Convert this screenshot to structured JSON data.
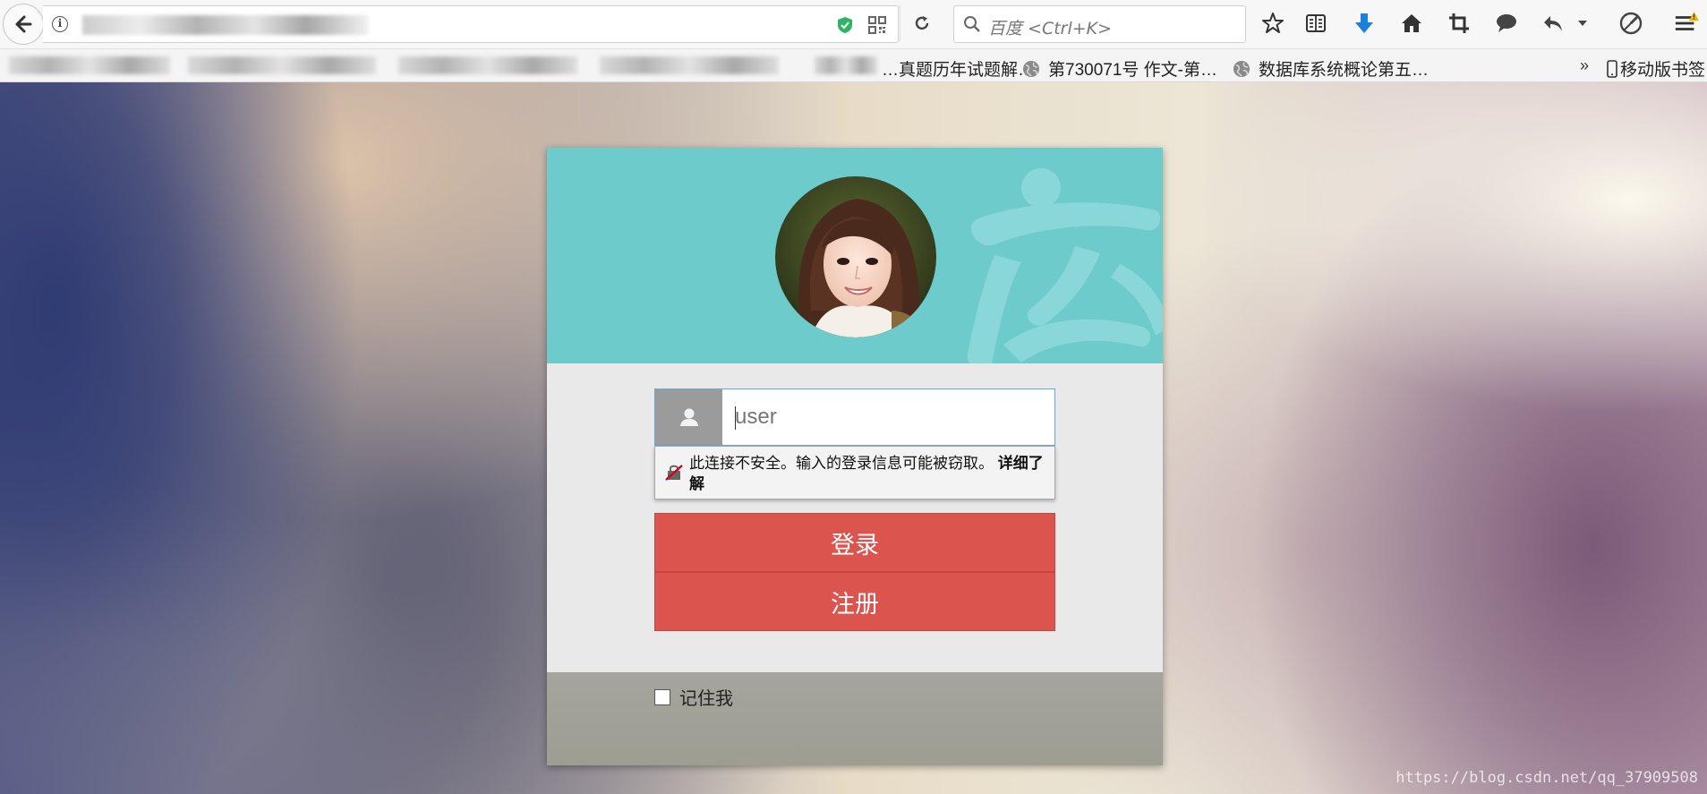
{
  "toolbar": {
    "search_placeholder": "百度 <Ctrl+K>",
    "icons": [
      "back-arrow-icon",
      "info-icon",
      "shield-icon",
      "qr-code-icon",
      "reload-icon",
      "search-icon",
      "bookmark-star-icon",
      "reading-list-icon",
      "download-icon",
      "home-icon",
      "crop-icon",
      "chat-icon",
      "undo-icon",
      "dropdown-icon",
      "speedometer-icon",
      "menu-icon"
    ]
  },
  "bookmarks": {
    "items": [
      "…真题历年试题解…",
      "第730071号 作文-第…",
      "数据库系统概论第五…"
    ],
    "overflow": "»",
    "mobile_label": "移动版书签"
  },
  "login": {
    "username_placeholder": "user",
    "security_warning": "此连接不安全。输入的登录信息可能被窃取。",
    "learn_more": "详细了解",
    "login_button": "登录",
    "register_button": "注册",
    "remember_me": "记住我"
  },
  "watermark": "https://blog.csdn.net/qq_37909508",
  "colors": {
    "header_teal": "#6ecbcc",
    "button_red": "#dc544e",
    "download_blue": "#1b7fe0"
  }
}
